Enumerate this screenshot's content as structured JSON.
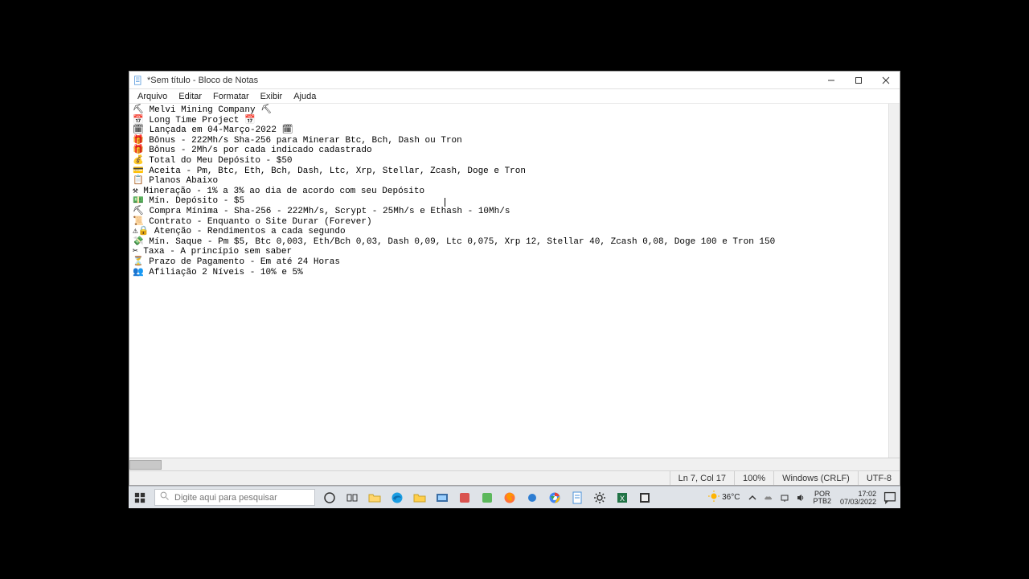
{
  "window": {
    "title": "*Sem título - Bloco de Notas"
  },
  "menu": {
    "file": "Arquivo",
    "edit": "Editar",
    "format": "Formatar",
    "view": "Exibir",
    "help": "Ajuda"
  },
  "content": {
    "line1": "⛏ Melvi Mining Company ⛏",
    "line2": "📅 Long Time Project 📅",
    "line3": "🗓 Lançada em 04-Março-2022 🗓",
    "line4": "🎁 Bônus - 222Mh/s Sha-256 para Minerar Btc, Bch, Dash ou Tron",
    "line5": "🎁 Bônus - 2Mh/s por cada indicado cadastrado",
    "line6": "💰 Total do Meu Depósito - $50",
    "line7": "💳 Aceita - Pm, Btc, Eth, Bch, Dash, Ltc, Xrp, Stellar, Zcash, Doge e Tron",
    "line8": "📋 Planos Abaixo",
    "line9": "⚒ Mineração - 1% a 3% ao dia de acordo com seu Depósito",
    "line10": "💵 Mín. Depósito - $5",
    "line11": "⛏ Compra Mínima - Sha-256 - 222Mh/s, Scrypt - 25Mh/s e Ethash - 10Mh/s",
    "line12": "📜 Contrato - Enquanto o Site Durar (Forever)",
    "line13": "⚠🔒 Atenção - Rendimentos a cada segundo",
    "line14": "💸 Mín. Saque - Pm $5, Btc 0,003, Eth/Bch 0,03, Dash 0,09, Ltc 0,075, Xrp 12, Stellar 40, Zcash 0,08, Doge 100 e Tron 150",
    "line15": "✂ Taxa - A princípio sem saber",
    "line16": "⏳ Prazo de Pagamento - Em até 24 Horas",
    "line17": "👥 Afiliação 2 Níveis - 10% e 5%"
  },
  "status": {
    "pos": "Ln 7, Col 17",
    "zoom": "100%",
    "eol": "Windows (CRLF)",
    "enc": "UTF-8"
  },
  "taskbar": {
    "search_placeholder": "Digite aqui para pesquisar"
  },
  "tray": {
    "temp": "36°C",
    "lang1": "POR",
    "lang2": "PTB2",
    "time": "17:02",
    "date": "07/03/2022"
  }
}
